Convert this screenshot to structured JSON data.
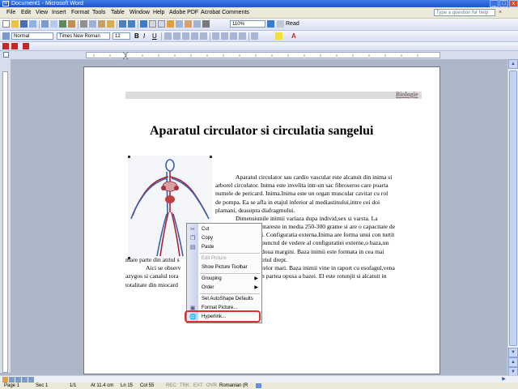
{
  "window": {
    "title": "Document1 - Microsoft Word",
    "min": "_",
    "max": "□",
    "close": "x"
  },
  "menu": {
    "items": [
      "File",
      "Edit",
      "View",
      "Insert",
      "Format",
      "Tools",
      "Table",
      "Window",
      "Help",
      "Adobe PDF",
      "Acrobat Comments"
    ],
    "help_placeholder": "Type a question for help"
  },
  "toolbar": {
    "zoom": "110%",
    "read": "Read",
    "style": "Normal",
    "font": "Times New Roman",
    "size": "12"
  },
  "document": {
    "header_text": "Biologie",
    "title": "Aparatul circulator si circulatia sangelui",
    "para_right": [
      "Aparatul circulator sau cardio vascular este alcatuit din inima si",
      "arborel circulator. Inima este invelita intr-un sac fibroseros care poarta",
      "numele de pericard. Inima.Inima este un organ muscular cavitar cu rol",
      "de pompa. Ea se afla in etajul inferior al mediastinului,intre cei doi",
      "plamani, deasupra diafragmului.",
      "Dimensiunile inimii variaza dupa individ,sex si varsta. La",
      "ntareste in media 250-300 grame si are o capacitate de",
      "i. Configuratia externa.Inima are forma unui con turtit",
      "punctul de vedere al configuratiei externe,o baza,un",
      "doua margini. Baza inimii este formata in cea mai",
      "triul drept.",
      "relor mari. Baza inimii vine in raport cu esofagul,vena",
      "n partea opusa a bazei. El este rotunjit si alcatuit in"
    ],
    "para_left": [
      "mare parte din atriul s",
      "Aici se observ",
      "azygos si canalul tora",
      "totalitate din miocard"
    ]
  },
  "context_menu": {
    "items": [
      {
        "label": "Cut",
        "enabled": true,
        "icon": "scissors-icon"
      },
      {
        "label": "Copy",
        "enabled": true,
        "icon": "copy-icon"
      },
      {
        "label": "Paste",
        "enabled": true,
        "icon": "paste-icon"
      },
      {
        "label": "Edit Picture",
        "enabled": false
      },
      {
        "label": "Show Picture Toolbar",
        "enabled": true
      },
      {
        "label": "Grouping",
        "enabled": true,
        "submenu": true
      },
      {
        "label": "Order",
        "enabled": true,
        "submenu": true
      },
      {
        "label": "Set AutoShape Defaults",
        "enabled": true
      },
      {
        "label": "Format Picture...",
        "enabled": true,
        "icon": "format-picture-icon"
      },
      {
        "label": "Hyperlink...",
        "enabled": true,
        "icon": "hyperlink-icon"
      }
    ]
  },
  "status": {
    "page": "Page 1",
    "sec": "Sec 1",
    "pages": "1/1",
    "at": "At 11.4 cm",
    "ln": "Ln 15",
    "col": "Col 55",
    "rec": "REC",
    "trk": "TRK",
    "ext": "EXT",
    "ovr": "OVR",
    "lang": "Romanian (R"
  },
  "colors": {
    "title_bar": "#2a62d6",
    "highlight_ring": "#e3302f",
    "menu_bg": "#ece9d8"
  }
}
